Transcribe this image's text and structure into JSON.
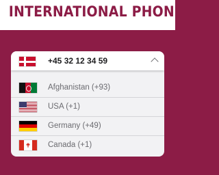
{
  "page": {
    "title": "INTERNATIONAL PHONE"
  },
  "phone_input": {
    "selected_country": "Denmark",
    "selected_flag_icon": "denmark-flag-icon",
    "value": "+45 32 12 34 59",
    "dropdown_state": "open"
  },
  "countries": [
    {
      "label": "Afghanistan (+93)",
      "flag_icon": "afghanistan-flag-icon"
    },
    {
      "label": "USA (+1)",
      "flag_icon": "usa-flag-icon"
    },
    {
      "label": "Germany (+49)",
      "flag_icon": "germany-flag-icon"
    },
    {
      "label": "Canada (+1)",
      "flag_icon": "canada-flag-icon"
    }
  ],
  "colors": {
    "brand": "#8c1c46",
    "header_background": "#ffffff",
    "widget_background": "#f2f2f4",
    "country_text": "#6b6b70"
  }
}
